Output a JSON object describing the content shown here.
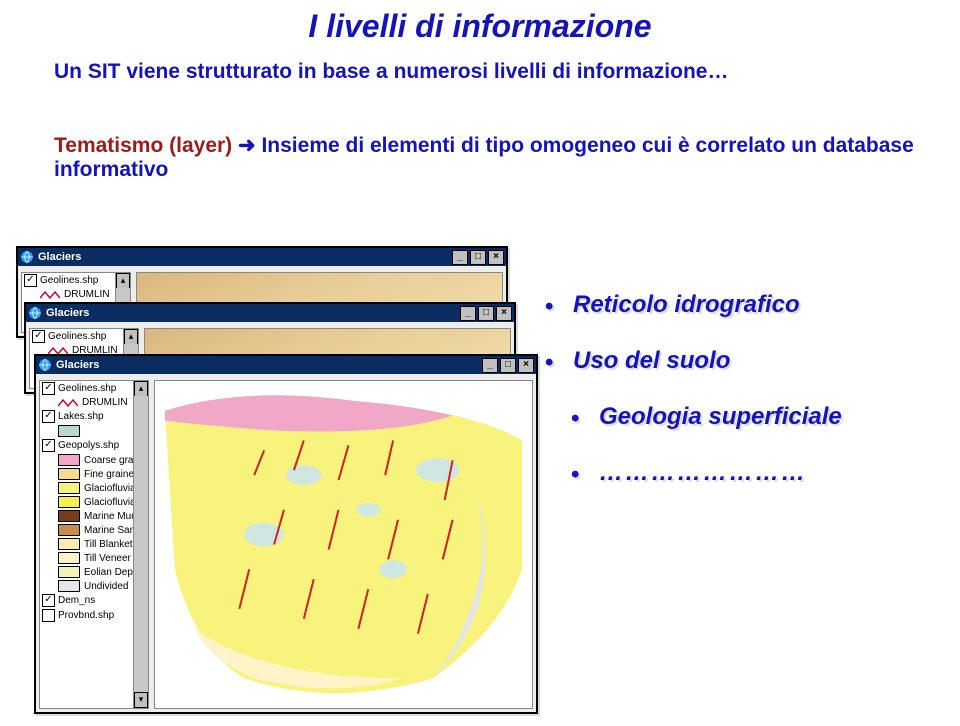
{
  "title": "I livelli di informazione",
  "intro": "Un SIT viene strutturato in base a numerosi livelli di informazione…",
  "definition": {
    "key": "Tematismo (layer)",
    "arrow": "➜",
    "rest": "Insieme di elementi di tipo omogeneo cui è correlato un database informativo"
  },
  "bullets": [
    "Reticolo idrografico",
    "Uso del suolo",
    "Geologia superficiale",
    "……………………"
  ],
  "window_title": "Glaciers",
  "win_btn_min": "_",
  "win_btn_max": "□",
  "win_btn_close": "×",
  "small_toc": {
    "layer1": "Geolines.shp",
    "sublayer1": "DRUMLIN"
  },
  "big_toc": {
    "items": [
      {
        "label": "Geolines.shp",
        "checked": true,
        "zig": true,
        "sub": "DRUMLIN"
      },
      {
        "label": "Lakes.shp",
        "checked": true,
        "swatch": "#b7d9d2"
      },
      {
        "label": "Geopolys.shp",
        "checked": true,
        "classes": [
          {
            "label": "Coarse graine",
            "color": "#f0a7c8"
          },
          {
            "label": "Fine grained (",
            "color": "#f6dc8e"
          },
          {
            "label": "Glaciofluvial C",
            "color": "#f7f37c"
          },
          {
            "label": "Glaciofluvial F",
            "color": "#f7f050"
          },
          {
            "label": "Marine Mud",
            "color": "#7a3b1d"
          },
          {
            "label": "Marine Sand",
            "color": "#c98c4a"
          },
          {
            "label": "Till Blanket",
            "color": "#ffeab0"
          },
          {
            "label": "Till Veneer",
            "color": "#fff2c8"
          },
          {
            "label": "Eolian Depos",
            "color": "#f0f5b6"
          },
          {
            "label": "Undivided",
            "color": "#e6e6e6"
          }
        ]
      },
      {
        "label": "Dem_ns",
        "checked": true
      },
      {
        "label": "Provbnd.shp",
        "checked": false
      }
    ]
  }
}
